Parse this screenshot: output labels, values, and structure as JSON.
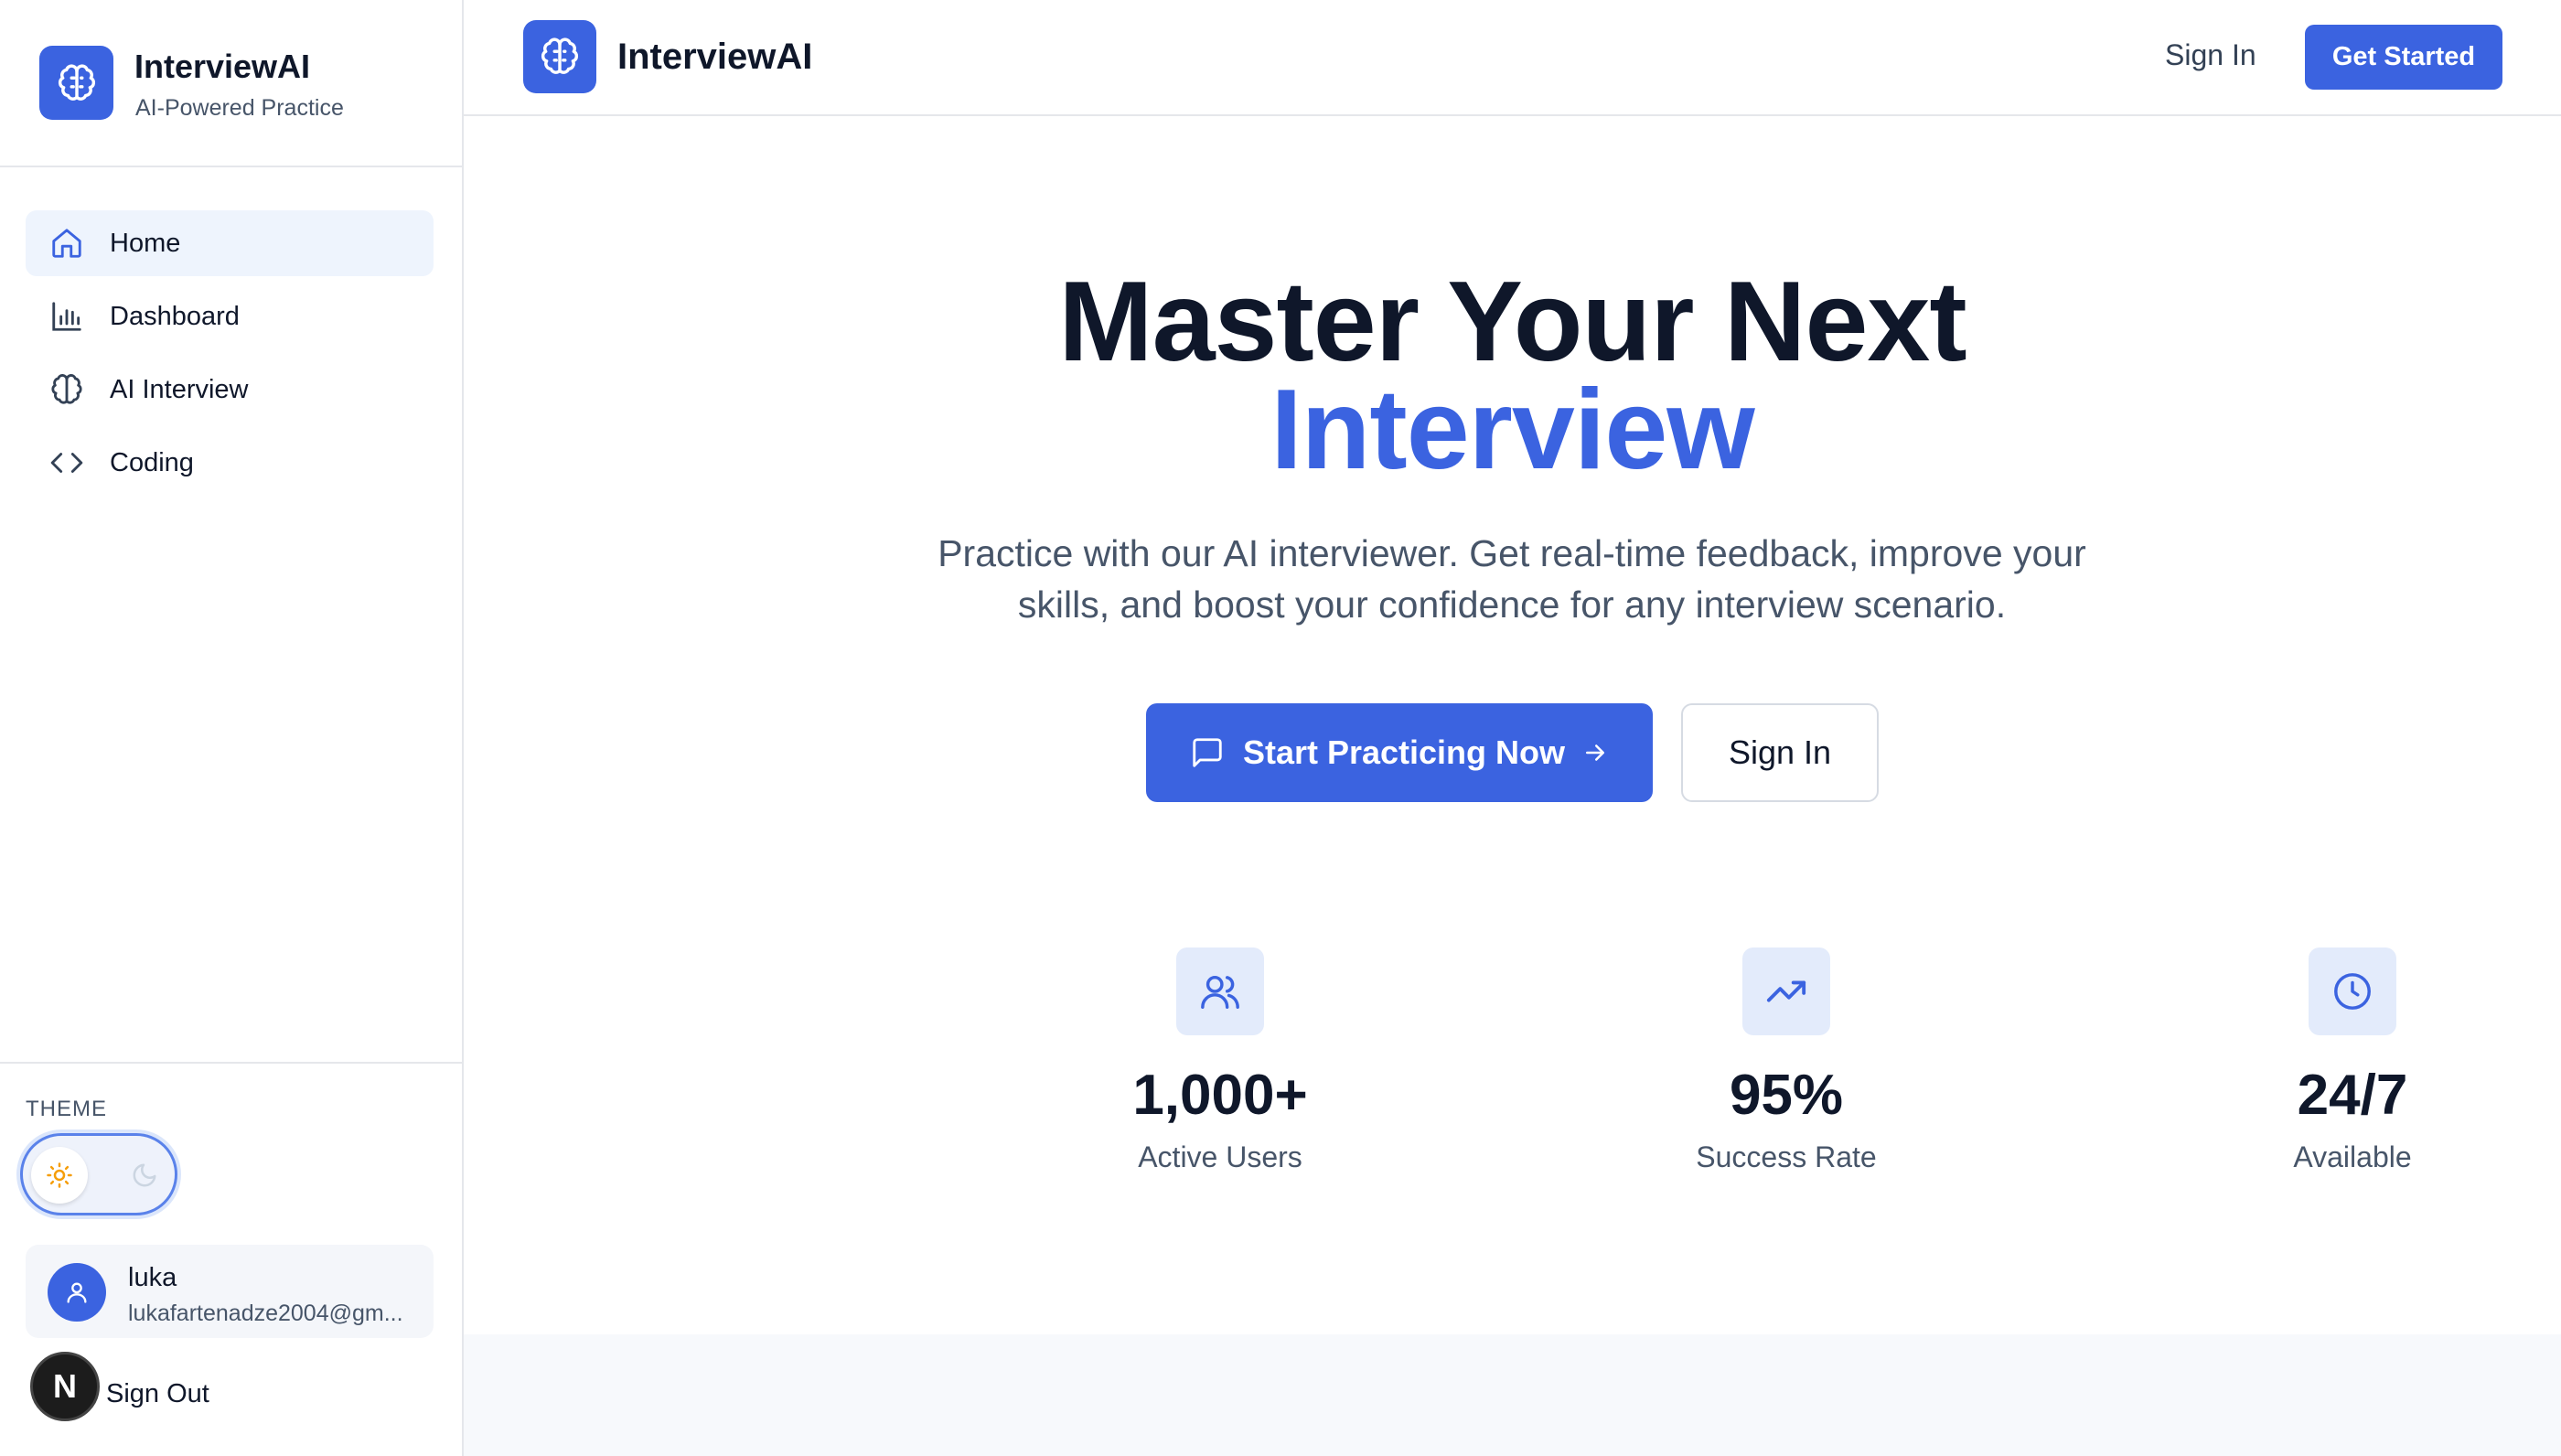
{
  "brand": {
    "name": "InterviewAI",
    "tagline": "AI-Powered Practice"
  },
  "sidebar": {
    "items": [
      {
        "label": "Home",
        "icon": "home-icon",
        "active": true
      },
      {
        "label": "Dashboard",
        "icon": "bar-chart-icon",
        "active": false
      },
      {
        "label": "AI Interview",
        "icon": "brain-icon",
        "active": false
      },
      {
        "label": "Coding",
        "icon": "code-icon",
        "active": false
      }
    ],
    "theme_label": "THEME",
    "theme_mode": "light",
    "user": {
      "name": "luka",
      "email": "lukafartenadze2004@gm..."
    },
    "badge_letter": "N",
    "sign_out": "Sign Out"
  },
  "topbar": {
    "title": "InterviewAI",
    "sign_in": "Sign In",
    "get_started": "Get Started"
  },
  "hero": {
    "title_line1": "Master Your Next",
    "title_line2": "Interview",
    "lead_line1": "Practice with our AI interviewer. Get real-time feedback, improve your",
    "lead_line2": "skills, and boost your confidence for any interview scenario.",
    "primary_cta": "Start Practicing Now",
    "secondary_cta": "Sign In"
  },
  "stats": [
    {
      "value": "1,000+",
      "label": "Active Users",
      "icon": "users-icon"
    },
    {
      "value": "95%",
      "label": "Success Rate",
      "icon": "trending-up-icon"
    },
    {
      "value": "24/7",
      "label": "Available",
      "icon": "clock-icon"
    }
  ],
  "colors": {
    "accent": "#3b63e0",
    "accent_light": "#e3ebfb",
    "nav_active_bg": "#eef4fd",
    "text": "#0f172a",
    "muted": "#475569"
  }
}
